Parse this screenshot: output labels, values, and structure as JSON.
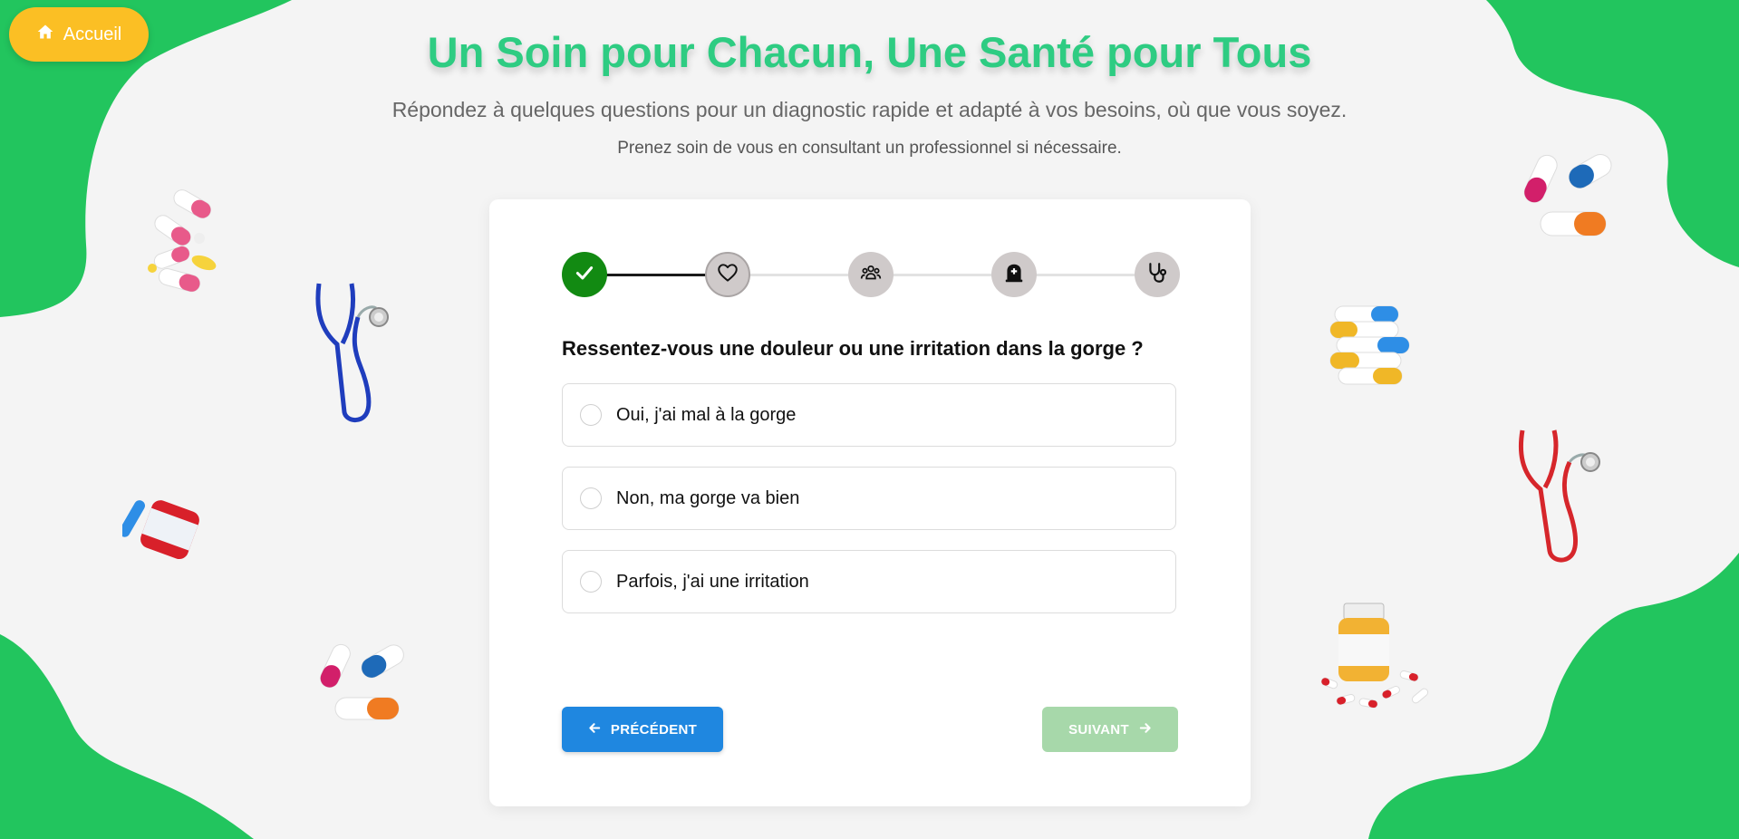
{
  "header": {
    "home_button_label": "Accueil",
    "title": "Un Soin pour Chacun, Une Santé pour Tous",
    "subtitle": "Répondez à quelques questions pour un diagnostic rapide et adapté à vos besoins, où que vous soyez.",
    "subtitle2": "Prenez soin de vous en consultant un professionnel si nécessaire."
  },
  "stepper": {
    "current_step": 2,
    "total_steps": 5,
    "steps": [
      {
        "icon": "check-icon",
        "status": "completed"
      },
      {
        "icon": "heart-icon",
        "status": "current"
      },
      {
        "icon": "people-group-icon",
        "status": "upcoming"
      },
      {
        "icon": "medical-tomb-icon",
        "status": "upcoming"
      },
      {
        "icon": "stethoscope-icon",
        "status": "upcoming"
      }
    ]
  },
  "question": {
    "text": "Ressentez-vous une douleur ou une irritation dans la gorge ?",
    "options": [
      {
        "label": "Oui, j'ai mal à la gorge",
        "selected": false
      },
      {
        "label": "Non, ma gorge va bien",
        "selected": false
      },
      {
        "label": "Parfois, j'ai une irritation",
        "selected": false
      }
    ]
  },
  "navigation": {
    "prev_label": "PRÉCÉDENT",
    "next_label": "SUIVANT",
    "next_enabled": false
  },
  "colors": {
    "accent_green": "#2ecc82",
    "blob_green": "#22c55e",
    "home_button": "#fbbf24",
    "prev_button": "#1f87e0",
    "next_button_disabled": "#a7d8aa",
    "step_done": "#128a12"
  },
  "decorations": [
    "pills-icon",
    "stethoscope-icon",
    "medicine-jar-icon",
    "capsules-icon",
    "pill-stack-icon",
    "pill-bottle-icon"
  ]
}
